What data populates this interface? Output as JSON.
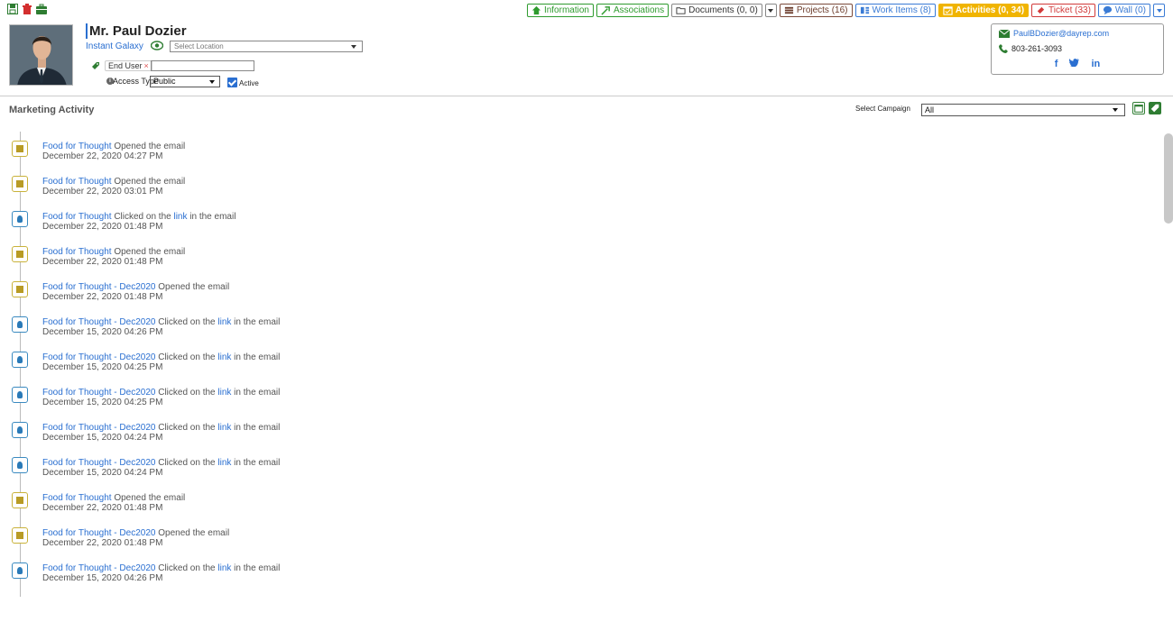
{
  "tabs": [
    {
      "label": "Information",
      "style": "green",
      "icon": "home-icon"
    },
    {
      "label": "Associations",
      "style": "green",
      "icon": "associations-icon"
    },
    {
      "label": "Documents (0, 0)",
      "style": "grey",
      "icon": "folder-icon"
    },
    {
      "label": "Projects (16)",
      "style": "brown",
      "icon": "projects-icon"
    },
    {
      "label": "Work Items (8)",
      "style": "blue",
      "icon": "work-items-icon"
    },
    {
      "label": "Activities (0, 34)",
      "style": "active",
      "icon": "calendar-icon"
    },
    {
      "label": "Ticket (33)",
      "style": "red",
      "icon": "ticket-icon"
    },
    {
      "label": "Wall (0)",
      "style": "blue",
      "icon": "chat-icon"
    }
  ],
  "profile": {
    "name": "Mr. Paul Dozier",
    "company": "Instant Galaxy",
    "location_placeholder": "Select Location",
    "tag": "End User",
    "tag_remove": "×",
    "access_label": "Access Type",
    "access_value": "Public",
    "active_label": "Active"
  },
  "contact": {
    "email": "PaulBDozier@dayrep.com",
    "phone": "803-261-3093",
    "social": [
      "f",
      "t",
      "in"
    ]
  },
  "marketing": {
    "title": "Marketing Activity",
    "campaign_label": "Select Campaign",
    "campaign_value": "All"
  },
  "activities": [
    {
      "type": "open",
      "campaign": "Food for Thought",
      "action": " Opened the email",
      "time": "December 22, 2020 04:27 PM"
    },
    {
      "type": "open",
      "campaign": "Food for Thought",
      "action": " Opened the email",
      "time": "December 22, 2020 03:01 PM"
    },
    {
      "type": "click",
      "campaign": "Food for Thought",
      "action": " Clicked on the ",
      "link": "link",
      "suffix": " in the email",
      "time": "December 22, 2020 01:48 PM"
    },
    {
      "type": "open",
      "campaign": "Food for Thought",
      "action": " Opened the email",
      "time": "December 22, 2020 01:48 PM"
    },
    {
      "type": "open",
      "campaign": "Food for Thought - Dec2020",
      "action": " Opened the email",
      "time": "December 22, 2020 01:48 PM"
    },
    {
      "type": "click",
      "campaign": "Food for Thought - Dec2020",
      "action": " Clicked on the ",
      "link": "link",
      "suffix": " in the email",
      "time": "December 15, 2020 04:26 PM"
    },
    {
      "type": "click",
      "campaign": "Food for Thought - Dec2020",
      "action": " Clicked on the ",
      "link": "link",
      "suffix": " in the email",
      "time": "December 15, 2020 04:25 PM"
    },
    {
      "type": "click",
      "campaign": "Food for Thought - Dec2020",
      "action": " Clicked on the ",
      "link": "link",
      "suffix": " in the email",
      "time": "December 15, 2020 04:25 PM"
    },
    {
      "type": "click",
      "campaign": "Food for Thought - Dec2020",
      "action": " Clicked on the ",
      "link": "link",
      "suffix": " in the email",
      "time": "December 15, 2020 04:24 PM"
    },
    {
      "type": "click",
      "campaign": "Food for Thought - Dec2020",
      "action": " Clicked on the ",
      "link": "link",
      "suffix": " in the email",
      "time": "December 15, 2020 04:24 PM"
    },
    {
      "type": "open",
      "campaign": "Food for Thought",
      "action": " Opened the email",
      "time": "December 22, 2020 01:48 PM"
    },
    {
      "type": "open",
      "campaign": "Food for Thought - Dec2020",
      "action": " Opened the email",
      "time": "December 22, 2020 01:48 PM"
    },
    {
      "type": "click",
      "campaign": "Food for Thought - Dec2020",
      "action": " Clicked on the ",
      "link": "link",
      "suffix": " in the email",
      "time": "December 15, 2020 04:26 PM"
    }
  ]
}
